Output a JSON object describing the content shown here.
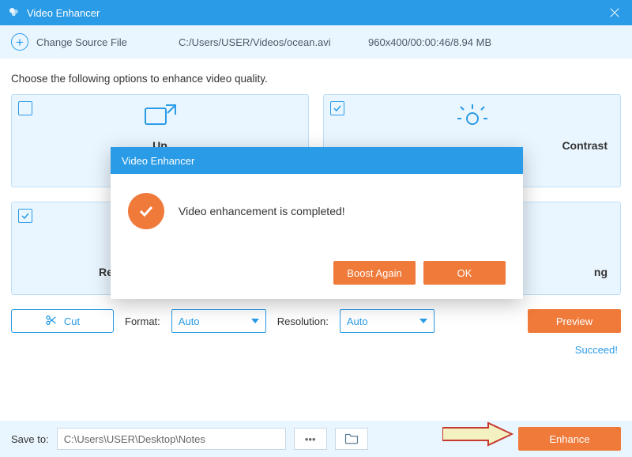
{
  "app": {
    "title": "Video Enhancer"
  },
  "source": {
    "change_label": "Change Source File",
    "path": "C:/Users/USER/Videos/ocean.avi",
    "meta": "960x400/00:00:46/8.94 MB"
  },
  "instruction": "Choose the following options to enhance video quality.",
  "cards": [
    {
      "title_prefix": "Up",
      "checked": false
    },
    {
      "title_suffix": "Contrast",
      "checked": true
    },
    {
      "title_prefix": "Ren",
      "checked": true
    },
    {
      "title_suffix": "ng",
      "checked": false
    }
  ],
  "toolbar": {
    "cut_label": "Cut",
    "format_label": "Format:",
    "format_value": "Auto",
    "resolution_label": "Resolution:",
    "resolution_value": "Auto",
    "preview_label": "Preview"
  },
  "status": "Succeed!",
  "save": {
    "label": "Save to:",
    "path": "C:\\Users\\USER\\Desktop\\Notes",
    "enhance_label": "Enhance"
  },
  "modal": {
    "title": "Video Enhancer",
    "message": "Video enhancement is completed!",
    "boost_label": "Boost Again",
    "ok_label": "OK"
  },
  "colors": {
    "accent": "#2a9be6",
    "action": "#ef7a3a",
    "panel": "#eaf6ff"
  }
}
